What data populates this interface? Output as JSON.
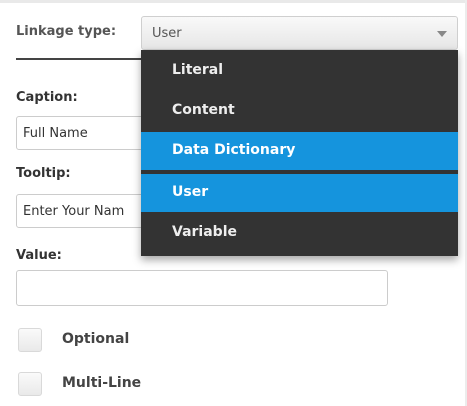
{
  "linkage": {
    "label": "Linkage type:",
    "selected": "User",
    "options": [
      {
        "label": "Literal",
        "highlighted": false
      },
      {
        "label": "Content",
        "highlighted": false
      },
      {
        "label": "Data Dictionary",
        "highlighted": true
      },
      {
        "label": "User",
        "highlighted": true
      },
      {
        "label": "Variable",
        "highlighted": false
      }
    ]
  },
  "form": {
    "caption_label": "Caption:",
    "caption_value": "Full Name",
    "tooltip_label": "Tooltip:",
    "tooltip_value": "Enter Your Nam",
    "value_label": "Value:",
    "value_value": ""
  },
  "options": {
    "optional_label": "Optional",
    "multiline_label": "Multi-Line"
  },
  "colors": {
    "dropdown_bg": "#333333",
    "highlight": "#1594dd"
  }
}
